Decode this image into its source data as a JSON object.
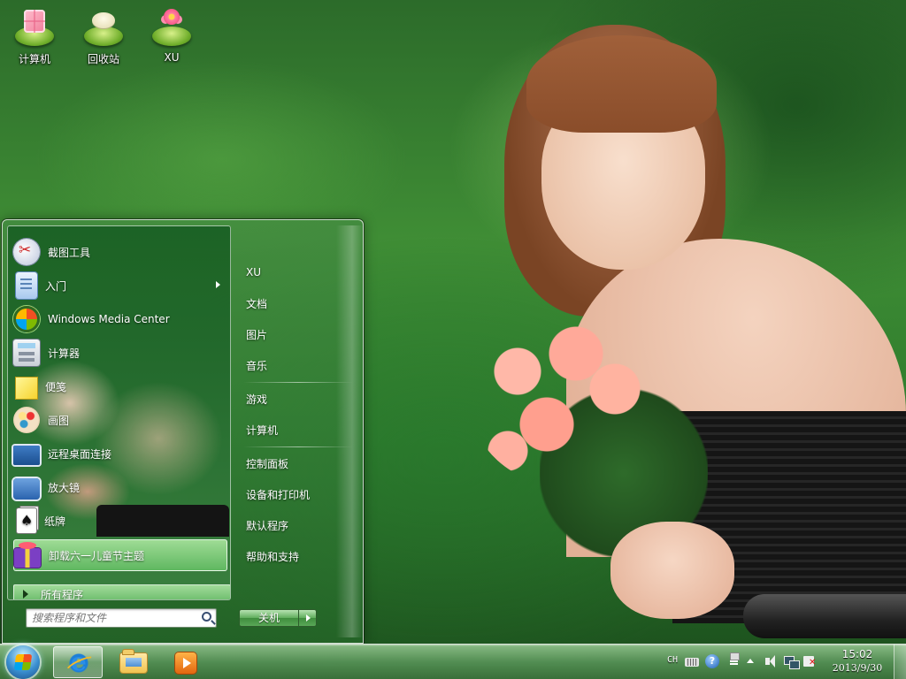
{
  "desktop": {
    "icons": [
      {
        "label": "计算机",
        "icon": "computer-icon"
      },
      {
        "label": "回收站",
        "icon": "recycle-bin-icon"
      },
      {
        "label": "XU",
        "icon": "user-folder-icon"
      }
    ]
  },
  "start_menu": {
    "programs": [
      {
        "label": "截图工具",
        "icon": "snipping-tool-icon"
      },
      {
        "label": "入门",
        "icon": "getting-started-icon",
        "has_submenu": true
      },
      {
        "label": "Windows Media Center",
        "icon": "media-center-icon"
      },
      {
        "label": "计算器",
        "icon": "calculator-icon"
      },
      {
        "label": "便笺",
        "icon": "sticky-notes-icon"
      },
      {
        "label": "画图",
        "icon": "paint-icon"
      },
      {
        "label": "远程桌面连接",
        "icon": "remote-desktop-icon"
      },
      {
        "label": "放大镜",
        "icon": "magnifier-icon"
      },
      {
        "label": "纸牌",
        "icon": "solitaire-icon"
      },
      {
        "label": "卸载六一儿童节主题",
        "icon": "uninstall-theme-icon",
        "highlighted": true
      }
    ],
    "all_programs": "所有程序",
    "right_items": [
      "XU",
      "文档",
      "图片",
      "音乐",
      "游戏",
      "计算机",
      "控制面板",
      "设备和打印机",
      "默认程序",
      "帮助和支持"
    ],
    "search_placeholder": "搜索程序和文件",
    "shutdown_label": "关机"
  },
  "taskbar": {
    "pinned": [
      {
        "name": "internet-explorer",
        "icon": "ie-icon",
        "active": true
      },
      {
        "name": "windows-explorer",
        "icon": "folder-icon",
        "active": false
      },
      {
        "name": "media-player",
        "icon": "media-player-icon",
        "active": false
      }
    ],
    "tray": {
      "language": "CH",
      "time": "15:02",
      "date": "2013/9/30"
    }
  },
  "colors": {
    "accent": "#5fad5c",
    "taskbar": "#5a965a",
    "highlight": "#8fd48a"
  }
}
